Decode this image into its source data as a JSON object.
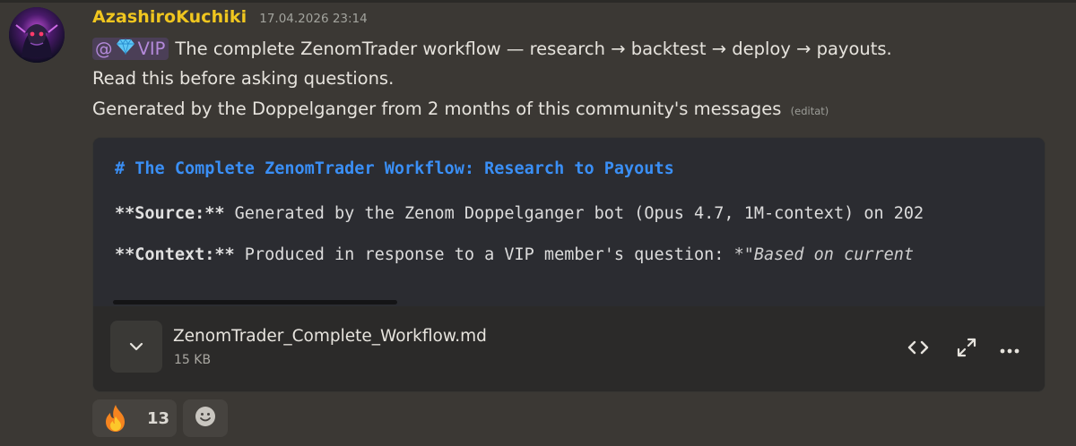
{
  "message": {
    "author": "AzashiroKuchiki",
    "timestamp": "17.04.2026 23:14",
    "mention": {
      "at": "@",
      "emoji_icon": "gem-icon",
      "label": "VIP"
    },
    "line1_text": "The complete ZenomTrader workflow — research → backtest → deploy → payouts.",
    "line2_text": "Read this before asking questions.",
    "line3_text": "Generated by the Doppelganger from 2 months of this community's messages",
    "edited_label": "(editat)"
  },
  "attachment": {
    "preview": {
      "title_line": "# The Complete ZenomTrader Workflow: Research to Payouts",
      "line2_bold": "**Source:**",
      "line2_text": " Generated by the Zenom Doppelganger bot (Opus 4.7, 1M-context) on 202",
      "line3_bold": "**Context:**",
      "line3_text": " Produced in response to a VIP member's question: ",
      "line3_italic": "*\"Based on current"
    },
    "file_name": "ZenomTrader_Complete_Workflow.md",
    "file_size": "15 KB",
    "actions": [
      "view-code-icon",
      "expand-fullscreen-icon",
      "more-options-icon"
    ]
  },
  "reactions": [
    {
      "emoji_icon": "fire-icon",
      "count": "13"
    }
  ],
  "add_reaction_icon": "smiley-icon",
  "colors": {
    "username": "#f0c61f",
    "mention": "#b48adb",
    "code_heading": "#3a8ff6",
    "background": "#3b3834"
  }
}
